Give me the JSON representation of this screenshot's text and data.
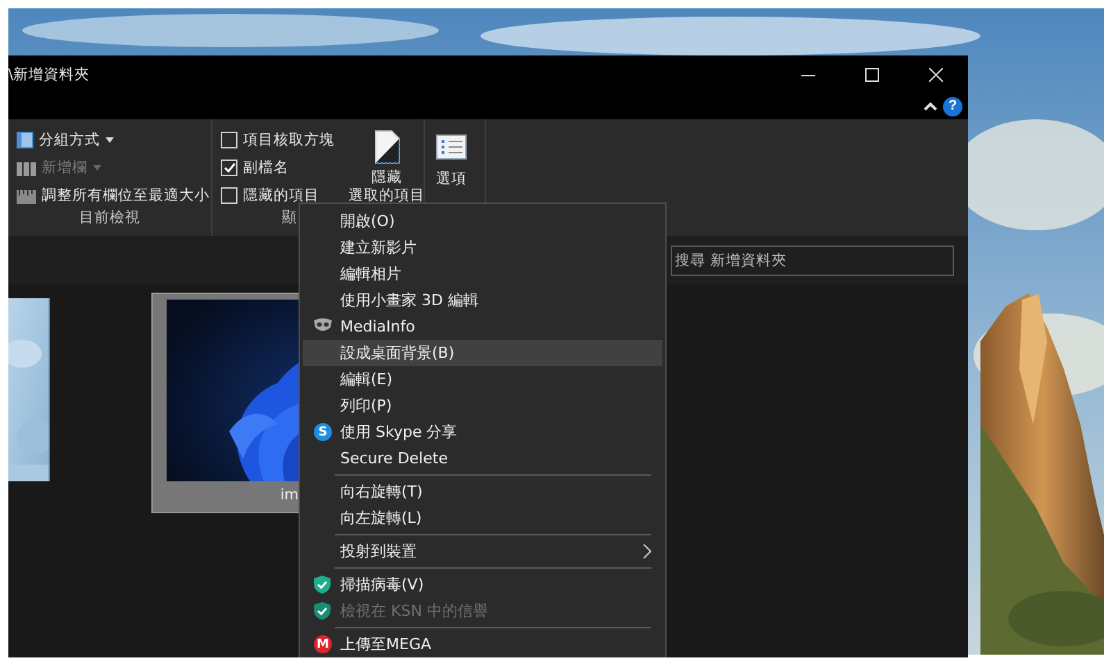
{
  "window": {
    "title": "\\新增資料夾",
    "help": "?"
  },
  "ribbon": {
    "groups": [
      {
        "label": "目前檢視",
        "items": [
          {
            "kind": "dropdown",
            "label": "分組方式",
            "disabled": false
          },
          {
            "kind": "dropdown",
            "label": "新增欄",
            "disabled": true
          },
          {
            "kind": "button",
            "label": "調整所有欄位至最適大小",
            "disabled": false
          }
        ]
      },
      {
        "label": "顯",
        "items": [
          {
            "kind": "checkbox",
            "label": "項目核取方塊",
            "checked": false
          },
          {
            "kind": "checkbox",
            "label": "副檔名",
            "checked": true
          },
          {
            "kind": "checkbox",
            "label": "隱藏的項目",
            "checked": false
          },
          {
            "kind": "large",
            "lines": [
              "隱藏",
              "選取的項目"
            ]
          }
        ]
      },
      {
        "items": [
          {
            "kind": "large",
            "lines": [
              "選項"
            ]
          }
        ]
      }
    ]
  },
  "search": {
    "placeholder": "搜尋 新增資料夾"
  },
  "files": [
    {
      "kind": "picture",
      "selected": false
    },
    {
      "kind": "picture",
      "label": "im",
      "selected": true
    }
  ],
  "context_menu": {
    "items": [
      {
        "kind": "item",
        "label": "開啟(O)",
        "selected": false,
        "disabled": false,
        "submenu": false
      },
      {
        "kind": "item",
        "label": "建立新影片",
        "selected": false,
        "disabled": false,
        "submenu": false
      },
      {
        "kind": "item",
        "label": "編輯相片",
        "selected": false,
        "disabled": false,
        "submenu": false
      },
      {
        "kind": "item",
        "label": "使用小畫家 3D 編輯",
        "selected": false,
        "disabled": false,
        "submenu": false
      },
      {
        "kind": "item",
        "label": "MediaInfo",
        "selected": false,
        "disabled": false,
        "submenu": false
      },
      {
        "kind": "item",
        "label": "設成桌面背景(B)",
        "selected": true,
        "disabled": false,
        "submenu": false
      },
      {
        "kind": "item",
        "label": "編輯(E)",
        "selected": false,
        "disabled": false,
        "submenu": false
      },
      {
        "kind": "item",
        "label": "列印(P)",
        "selected": false,
        "disabled": false,
        "submenu": false
      },
      {
        "kind": "item",
        "label": "使用 Skype 分享",
        "selected": false,
        "disabled": false,
        "submenu": false,
        "icon_text": "S",
        "color": "#1e8fe0"
      },
      {
        "kind": "item",
        "label": "Secure Delete",
        "selected": false,
        "disabled": false,
        "submenu": false
      },
      {
        "kind": "separator"
      },
      {
        "kind": "item",
        "label": "向右旋轉(T)",
        "selected": false,
        "disabled": false,
        "submenu": false
      },
      {
        "kind": "item",
        "label": "向左旋轉(L)",
        "selected": false,
        "disabled": false,
        "submenu": false
      },
      {
        "kind": "separator"
      },
      {
        "kind": "item",
        "label": "投射到裝置",
        "selected": false,
        "disabled": false,
        "submenu": true
      },
      {
        "kind": "separator"
      },
      {
        "kind": "item",
        "label": "掃描病毒(V)",
        "selected": false,
        "disabled": false,
        "submenu": false
      },
      {
        "kind": "item",
        "label": "檢視在 KSN 中的信譽",
        "selected": false,
        "disabled": true,
        "submenu": false
      },
      {
        "kind": "separator"
      },
      {
        "kind": "item",
        "label": "上傳至MEGA",
        "selected": false,
        "disabled": false,
        "submenu": false,
        "icon_text": "M",
        "color": "#d9272e"
      }
    ]
  }
}
